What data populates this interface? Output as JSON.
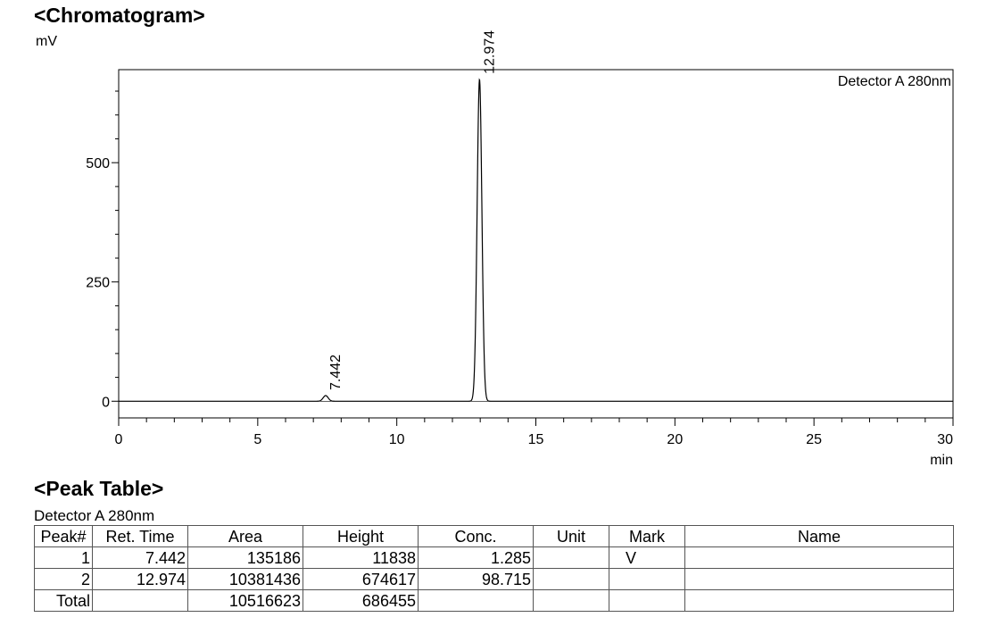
{
  "titles": {
    "chromatogram": "<Chromatogram>",
    "peak_table": "<Peak Table>"
  },
  "chart_data": {
    "type": "line",
    "ylabel": "mV",
    "xlabel": "min",
    "detector_label": "Detector A 280nm",
    "xlim": [
      0,
      30
    ],
    "ylim": [
      -35,
      695
    ],
    "x_ticks": [
      0,
      5,
      10,
      15,
      20,
      25,
      30
    ],
    "y_ticks": [
      0,
      250,
      500
    ],
    "grid": false,
    "peaks": [
      {
        "label": "7.442",
        "ret_time": 7.442,
        "height_mv": 11.8,
        "sigma_min": 0.09
      },
      {
        "label": "12.974",
        "ret_time": 12.974,
        "height_mv": 674.6,
        "sigma_min": 0.085
      }
    ],
    "baseline_mv": 0
  },
  "peak_table": {
    "caption": "Detector A 280nm",
    "headers": [
      "Peak#",
      "Ret. Time",
      "Area",
      "Height",
      "Conc.",
      "Unit",
      "Mark",
      "Name"
    ],
    "rows": [
      [
        "1",
        "7.442",
        "135186",
        "11838",
        "1.285",
        "",
        "V",
        ""
      ],
      [
        "2",
        "12.974",
        "10381436",
        "674617",
        "98.715",
        "",
        "",
        ""
      ],
      [
        "Total",
        "",
        "10516623",
        "686455",
        "",
        "",
        "",
        ""
      ]
    ]
  }
}
